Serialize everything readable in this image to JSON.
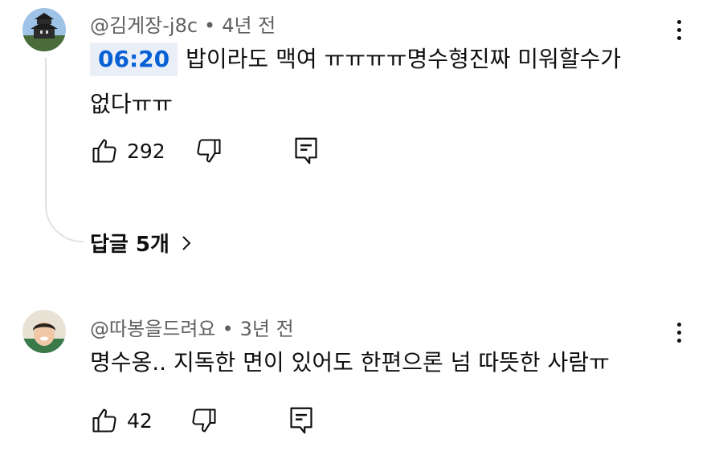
{
  "comments": [
    {
      "author": "@김게장-j8c",
      "age": "4년 전",
      "timestamp": "06:20",
      "text_line1": "밥이라도 맥여 ㅠㅠㅠㅠ명수형진짜 미워할수가",
      "text_line2": "없다ㅠㅠ",
      "likes": "292",
      "replies_label": "답글 5개",
      "avatar_icon": "castle-avatar"
    },
    {
      "author": "@따봉을드려요",
      "age": "3년 전",
      "text": "명수옹.. 지독한 면이 있어도 한편으론 넘 따뜻한 사람ㅠ",
      "likes": "42",
      "avatar_icon": "person-avatar"
    }
  ],
  "colors": {
    "accent": "#065fd4",
    "timestamp_bg": "#e9eef7",
    "meta": "#606060"
  }
}
